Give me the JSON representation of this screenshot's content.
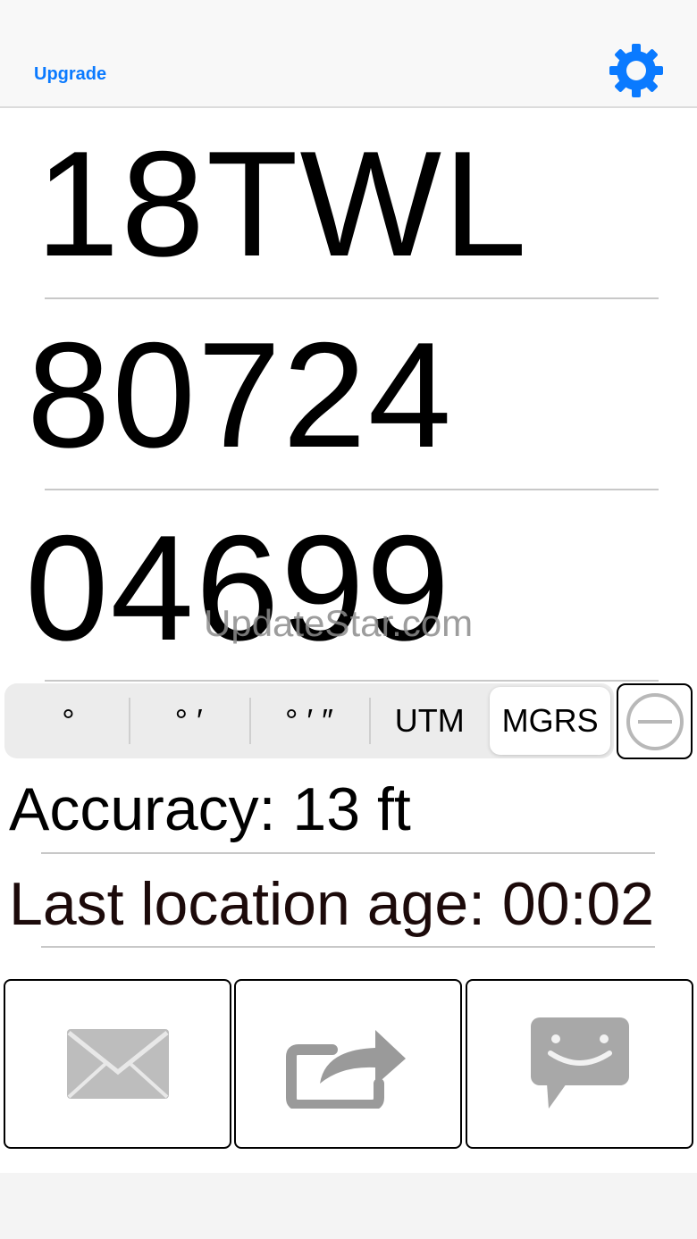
{
  "colors": {
    "accent": "#0a7aff",
    "icon_gray": "#a8a8a8",
    "age_text": "#1c0a0a"
  },
  "navbar": {
    "upgrade_label": "Upgrade",
    "settings_icon": "gear-icon"
  },
  "coordinates": {
    "grid_zone": "18TWL",
    "easting": "80724",
    "northing": "04699"
  },
  "watermark": "UpdateStar.com",
  "format_selector": {
    "options": [
      "°",
      "° ′",
      "° ′ ″",
      "UTM",
      "MGRS"
    ],
    "selected": "MGRS"
  },
  "remove_icon": "minus-circle-icon",
  "accuracy": "Accuracy: 13 ft",
  "location_age": "Last location age: 00:02",
  "actions": [
    {
      "name": "email",
      "icon": "envelope-icon"
    },
    {
      "name": "share",
      "icon": "share-icon"
    },
    {
      "name": "message",
      "icon": "chat-bubble-icon"
    }
  ]
}
